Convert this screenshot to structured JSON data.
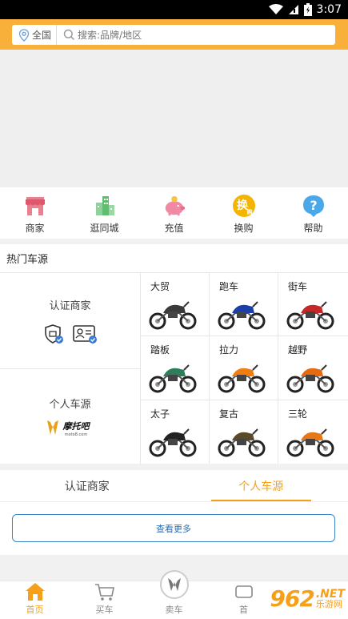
{
  "status_bar": {
    "time": "3:07",
    "icons": [
      "wifi-icon",
      "sim-icon",
      "battery-icon"
    ]
  },
  "header": {
    "region_label": "全国",
    "search_placeholder": "搜索:品牌/地区"
  },
  "quick_nav": [
    {
      "label": "商家",
      "icon": "store-icon"
    },
    {
      "label": "逛同城",
      "icon": "city-icon"
    },
    {
      "label": "充值",
      "icon": "piggy-bank-icon"
    },
    {
      "label": "换购",
      "icon": "exchange-icon",
      "icon_text": "换",
      "icon_subtext": "购"
    },
    {
      "label": "帮助",
      "icon": "help-icon",
      "icon_text": "?"
    }
  ],
  "hot": {
    "title": "热门车源",
    "certified_label": "认证商家",
    "personal_label": "个人车源",
    "logo_text": "摩托吧",
    "logo_subtext": "moto8.com",
    "categories": [
      {
        "label": "大贸",
        "color": "#3a3a3a"
      },
      {
        "label": "跑车",
        "color": "#1a3fa8"
      },
      {
        "label": "街车",
        "color": "#c62828"
      },
      {
        "label": "踏板",
        "color": "#2e7d5b"
      },
      {
        "label": "拉力",
        "color": "#ef7d12"
      },
      {
        "label": "越野",
        "color": "#e86a10"
      },
      {
        "label": "太子",
        "color": "#222222"
      },
      {
        "label": "复古",
        "color": "#5a4a2a"
      },
      {
        "label": "三轮",
        "color": "#e67817"
      }
    ]
  },
  "tabs": [
    {
      "label": "认证商家",
      "active": false
    },
    {
      "label": "个人车源",
      "active": true
    }
  ],
  "more_button": "查看更多",
  "bottom_nav": [
    {
      "label": "首页",
      "icon": "home-icon",
      "active": true
    },
    {
      "label": "买车",
      "icon": "cart-icon",
      "active": false
    },
    {
      "label": "卖车",
      "icon": "moto-logo-icon",
      "active": false
    },
    {
      "label": "首",
      "icon": "message-icon",
      "active": false
    }
  ],
  "watermark": {
    "number": "962",
    "net": ".NET",
    "cn": "乐游网"
  },
  "colors": {
    "accent": "#f8b03a",
    "active": "#f5a018",
    "button_border": "#3a86c8"
  }
}
